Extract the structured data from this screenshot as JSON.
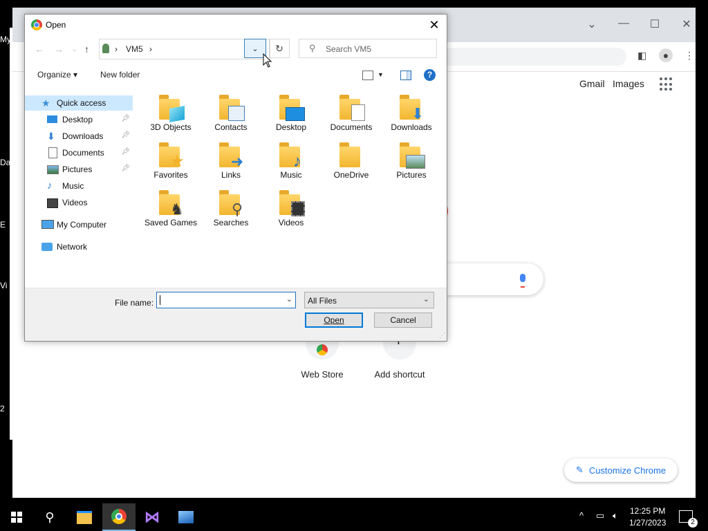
{
  "desktop": {
    "labels": [
      "My",
      "Da",
      "E",
      "Vi",
      "2"
    ]
  },
  "chrome": {
    "gmail": "Gmail",
    "images": "Images",
    "shortcuts": [
      {
        "label": "Web Store"
      },
      {
        "label": "Add shortcut"
      }
    ],
    "customize": "Customize Chrome"
  },
  "dialog": {
    "title": "Open",
    "breadcrumb": [
      "VM5"
    ],
    "search_placeholder": "Search VM5",
    "organize": "Organize",
    "new_folder": "New folder",
    "nav": [
      {
        "label": "Quick access",
        "icon": "star-icon",
        "selected": true
      },
      {
        "label": "Desktop",
        "icon": "desktop-icon",
        "pinned": true
      },
      {
        "label": "Downloads",
        "icon": "downloads-icon",
        "pinned": true
      },
      {
        "label": "Documents",
        "icon": "documents-icon",
        "pinned": true
      },
      {
        "label": "Pictures",
        "icon": "pictures-icon",
        "pinned": true
      },
      {
        "label": "Music",
        "icon": "music-icon"
      },
      {
        "label": "Videos",
        "icon": "videos-icon"
      },
      {
        "label": "My Computer",
        "icon": "computer-icon"
      },
      {
        "label": "Network",
        "icon": "network-icon"
      }
    ],
    "folders": [
      {
        "label": "3D Objects",
        "overlay": "cube"
      },
      {
        "label": "Contacts",
        "overlay": "card"
      },
      {
        "label": "Desktop",
        "overlay": "screen"
      },
      {
        "label": "Documents",
        "overlay": "doc"
      },
      {
        "label": "Downloads",
        "overlay": "arrow"
      },
      {
        "label": "Favorites",
        "overlay": "star"
      },
      {
        "label": "Links",
        "overlay": "link"
      },
      {
        "label": "Music",
        "overlay": "note"
      },
      {
        "label": "OneDrive",
        "overlay": "none"
      },
      {
        "label": "Pictures",
        "overlay": "photo"
      },
      {
        "label": "Saved Games",
        "overlay": "chess"
      },
      {
        "label": "Searches",
        "overlay": "magnifier"
      },
      {
        "label": "Videos",
        "overlay": "film"
      }
    ],
    "file_name_label": "File name:",
    "file_name_value": "",
    "filter_value": "All Files",
    "open_label": "Open",
    "cancel_label": "Cancel"
  },
  "taskbar": {
    "time": "12:25 PM",
    "date": "1/27/2023",
    "notification_count": "2"
  }
}
